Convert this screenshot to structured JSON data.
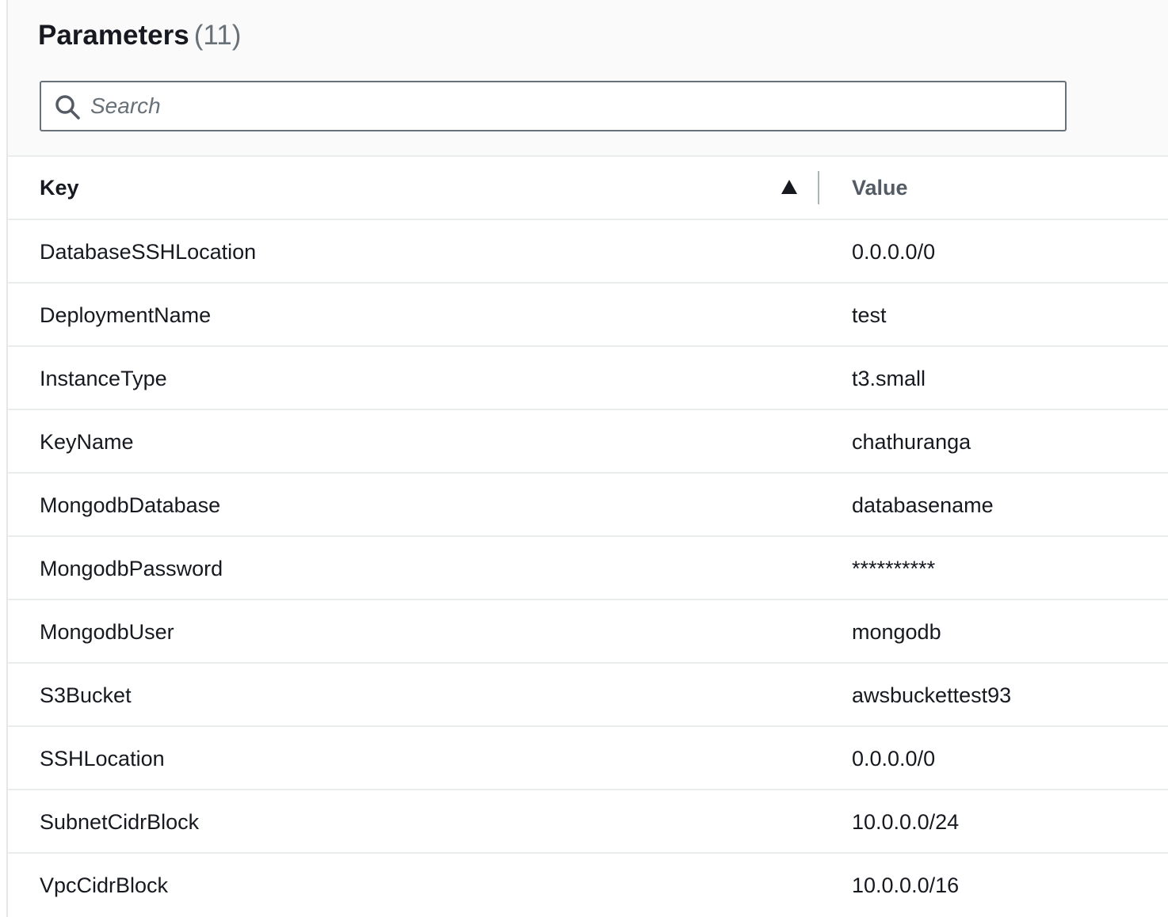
{
  "header": {
    "title": "Parameters",
    "count": "(11)"
  },
  "search": {
    "placeholder": "Search",
    "value": ""
  },
  "table": {
    "columns": {
      "key": "Key",
      "value": "Value"
    },
    "sort": {
      "column": "key",
      "direction": "ascending",
      "icon": "triangle-up-icon"
    },
    "rows": [
      {
        "key": "DatabaseSSHLocation",
        "value": "0.0.0.0/0"
      },
      {
        "key": "DeploymentName",
        "value": "test"
      },
      {
        "key": "InstanceType",
        "value": "t3.small"
      },
      {
        "key": "KeyName",
        "value": "chathuranga"
      },
      {
        "key": "MongodbDatabase",
        "value": "databasename"
      },
      {
        "key": "MongodbPassword",
        "value": "**********"
      },
      {
        "key": "MongodbUser",
        "value": "mongodb"
      },
      {
        "key": "S3Bucket",
        "value": "awsbuckettest93"
      },
      {
        "key": "SSHLocation",
        "value": "0.0.0.0/0"
      },
      {
        "key": "SubnetCidrBlock",
        "value": "10.0.0.0/24"
      },
      {
        "key": "VpcCidrBlock",
        "value": "10.0.0.0/16"
      }
    ]
  },
  "colors": {
    "text": "#16191f",
    "muted": "#687078",
    "border": "#eaeded",
    "header_bg": "#fafafa"
  }
}
